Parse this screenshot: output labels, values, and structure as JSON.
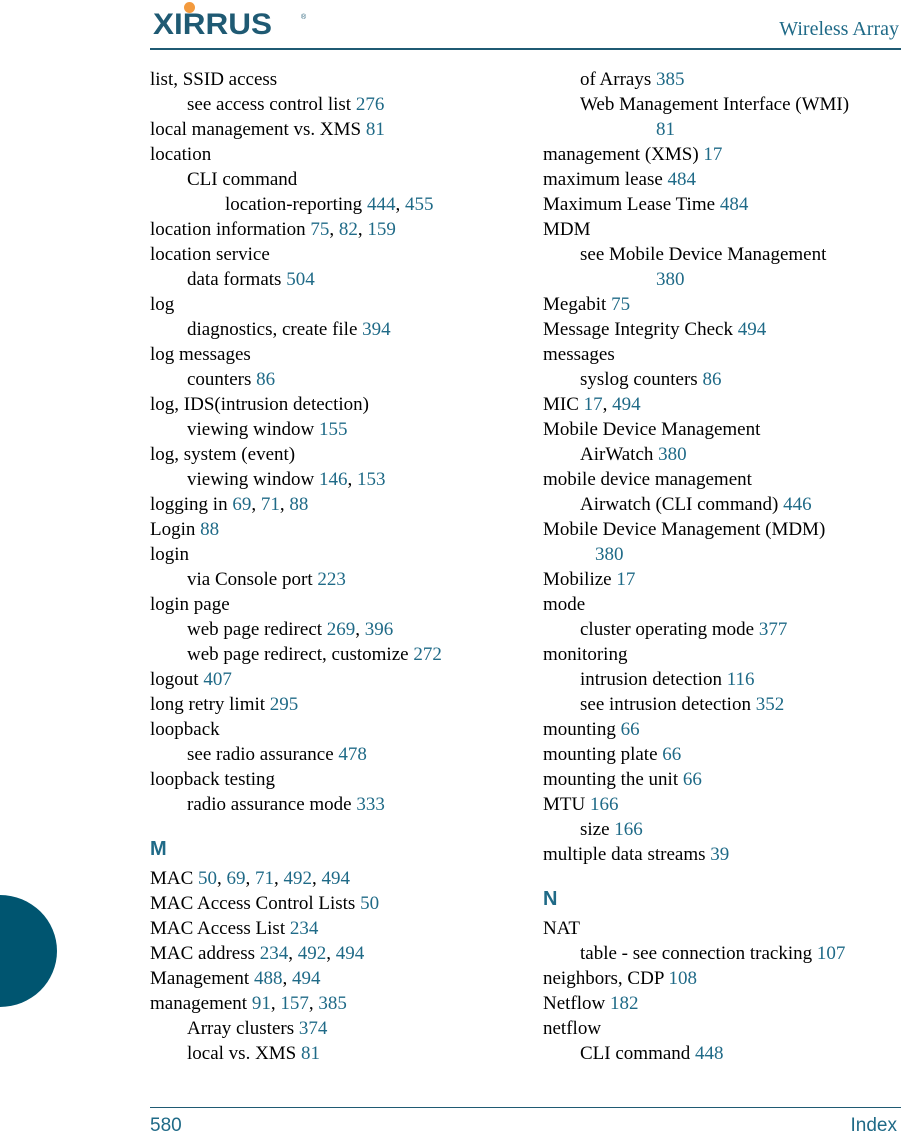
{
  "header": {
    "logo_text": "XIRRUS",
    "logo_registered": "®",
    "title": "Wireless Array"
  },
  "colors": {
    "accent": "#1f6a87",
    "tab": "#005570",
    "logo_dot": "#f39a3d"
  },
  "left_column": [
    {
      "level": 0,
      "term": "list, SSID access",
      "pages": []
    },
    {
      "level": 1,
      "term": "see access control list",
      "pages": [
        "276"
      ]
    },
    {
      "level": 0,
      "term": "local management vs. XMS",
      "pages": [
        "81"
      ]
    },
    {
      "level": 0,
      "term": "location",
      "pages": []
    },
    {
      "level": 1,
      "term": "CLI command",
      "pages": []
    },
    {
      "level": 2,
      "term": "location-reporting",
      "pages": [
        "444",
        "455"
      ]
    },
    {
      "level": 0,
      "term": "location information",
      "pages": [
        "75",
        "82",
        "159"
      ]
    },
    {
      "level": 0,
      "term": "location service",
      "pages": []
    },
    {
      "level": 1,
      "term": "data formats",
      "pages": [
        "504"
      ]
    },
    {
      "level": 0,
      "term": "log",
      "pages": []
    },
    {
      "level": 1,
      "term": "diagnostics, create file",
      "pages": [
        "394"
      ]
    },
    {
      "level": 0,
      "term": "log messages",
      "pages": []
    },
    {
      "level": 1,
      "term": "counters",
      "pages": [
        "86"
      ]
    },
    {
      "level": 0,
      "term": "log, IDS(intrusion detection)",
      "pages": []
    },
    {
      "level": 1,
      "term": "viewing window",
      "pages": [
        "155"
      ]
    },
    {
      "level": 0,
      "term": "log, system (event)",
      "pages": []
    },
    {
      "level": 1,
      "term": "viewing window",
      "pages": [
        "146",
        "153"
      ]
    },
    {
      "level": 0,
      "term": "logging in",
      "pages": [
        "69",
        "71",
        "88"
      ]
    },
    {
      "level": 0,
      "term": "Login",
      "pages": [
        "88"
      ]
    },
    {
      "level": 0,
      "term": "login",
      "pages": []
    },
    {
      "level": 1,
      "term": "via Console port",
      "pages": [
        "223"
      ]
    },
    {
      "level": 0,
      "term": "login page",
      "pages": []
    },
    {
      "level": 1,
      "term": "web page redirect",
      "pages": [
        "269",
        "396"
      ]
    },
    {
      "level": 1,
      "term": "web page redirect, customize",
      "pages": [
        "272"
      ]
    },
    {
      "level": 0,
      "term": "logout",
      "pages": [
        "407"
      ]
    },
    {
      "level": 0,
      "term": "long retry limit",
      "pages": [
        "295"
      ]
    },
    {
      "level": 0,
      "term": "loopback",
      "pages": []
    },
    {
      "level": 1,
      "term": "see radio assurance",
      "pages": [
        "478"
      ]
    },
    {
      "level": 0,
      "term": "loopback testing",
      "pages": []
    },
    {
      "level": 1,
      "term": "radio assurance mode",
      "pages": [
        "333"
      ]
    },
    {
      "letter": "M"
    },
    {
      "level": 0,
      "term": "MAC",
      "pages": [
        "50",
        "69",
        "71",
        "492",
        "494"
      ]
    },
    {
      "level": 0,
      "term": "MAC Access Control Lists",
      "pages": [
        "50"
      ]
    },
    {
      "level": 0,
      "term": "MAC Access List",
      "pages": [
        "234"
      ]
    },
    {
      "level": 0,
      "term": "MAC address",
      "pages": [
        "234",
        "492",
        "494"
      ]
    },
    {
      "level": 0,
      "term": "Management",
      "pages": [
        "488",
        "494"
      ]
    },
    {
      "level": 0,
      "term": "management",
      "pages": [
        "91",
        "157",
        "385"
      ]
    },
    {
      "level": 1,
      "term": "Array clusters",
      "pages": [
        "374"
      ]
    },
    {
      "level": 1,
      "term": "local vs. XMS",
      "pages": [
        "81"
      ]
    }
  ],
  "right_column": [
    {
      "level": 1,
      "term": "of Arrays",
      "pages": [
        "385"
      ]
    },
    {
      "level": 1,
      "term": "Web Management Interface (WMI)",
      "pages": [
        "81"
      ],
      "wrap": true
    },
    {
      "level": 0,
      "term": "management (XMS)",
      "pages": [
        "17"
      ]
    },
    {
      "level": 0,
      "term": "maximum lease",
      "pages": [
        "484"
      ]
    },
    {
      "level": 0,
      "term": "Maximum Lease Time",
      "pages": [
        "484"
      ]
    },
    {
      "level": 0,
      "term": "MDM",
      "pages": []
    },
    {
      "level": 1,
      "term": "see Mobile Device Management",
      "pages": [
        "380"
      ],
      "wrap": true
    },
    {
      "level": 0,
      "term": "Megabit",
      "pages": [
        "75"
      ]
    },
    {
      "level": 0,
      "term": "Message Integrity Check",
      "pages": [
        "494"
      ]
    },
    {
      "level": 0,
      "term": "messages",
      "pages": []
    },
    {
      "level": 1,
      "term": "syslog counters",
      "pages": [
        "86"
      ]
    },
    {
      "level": 0,
      "term": "MIC",
      "pages": [
        "17",
        "494"
      ]
    },
    {
      "level": 0,
      "term": "Mobile Device Management",
      "pages": []
    },
    {
      "level": 1,
      "term": "AirWatch",
      "pages": [
        "380"
      ]
    },
    {
      "level": 0,
      "term": "mobile device management",
      "pages": []
    },
    {
      "level": 1,
      "term": "Airwatch (CLI command)",
      "pages": [
        "446"
      ]
    },
    {
      "level": 0,
      "term": "Mobile Device Management (MDM)",
      "pages": [
        "380"
      ],
      "wrap": true
    },
    {
      "level": 0,
      "term": "Mobilize",
      "pages": [
        "17"
      ]
    },
    {
      "level": 0,
      "term": "mode",
      "pages": []
    },
    {
      "level": 1,
      "term": "cluster operating mode",
      "pages": [
        "377"
      ]
    },
    {
      "level": 0,
      "term": "monitoring",
      "pages": []
    },
    {
      "level": 1,
      "term": "intrusion detection",
      "pages": [
        "116"
      ]
    },
    {
      "level": 1,
      "term": "see intrusion detection",
      "pages": [
        "352"
      ]
    },
    {
      "level": 0,
      "term": "mounting",
      "pages": [
        "66"
      ]
    },
    {
      "level": 0,
      "term": "mounting plate",
      "pages": [
        "66"
      ]
    },
    {
      "level": 0,
      "term": "mounting the unit",
      "pages": [
        "66"
      ]
    },
    {
      "level": 0,
      "term": "MTU",
      "pages": [
        "166"
      ]
    },
    {
      "level": 1,
      "term": "size",
      "pages": [
        "166"
      ]
    },
    {
      "level": 0,
      "term": "multiple data streams",
      "pages": [
        "39"
      ]
    },
    {
      "letter": "N"
    },
    {
      "level": 0,
      "term": "NAT",
      "pages": []
    },
    {
      "level": 1,
      "term": "table - see connection tracking",
      "pages": [
        "107"
      ]
    },
    {
      "level": 0,
      "term": "neighbors, CDP",
      "pages": [
        "108"
      ]
    },
    {
      "level": 0,
      "term": "Netflow",
      "pages": [
        "182"
      ]
    },
    {
      "level": 0,
      "term": "netflow",
      "pages": []
    },
    {
      "level": 1,
      "term": "CLI command",
      "pages": [
        "448"
      ]
    }
  ],
  "footer": {
    "page_number": "580",
    "section": "Index"
  }
}
